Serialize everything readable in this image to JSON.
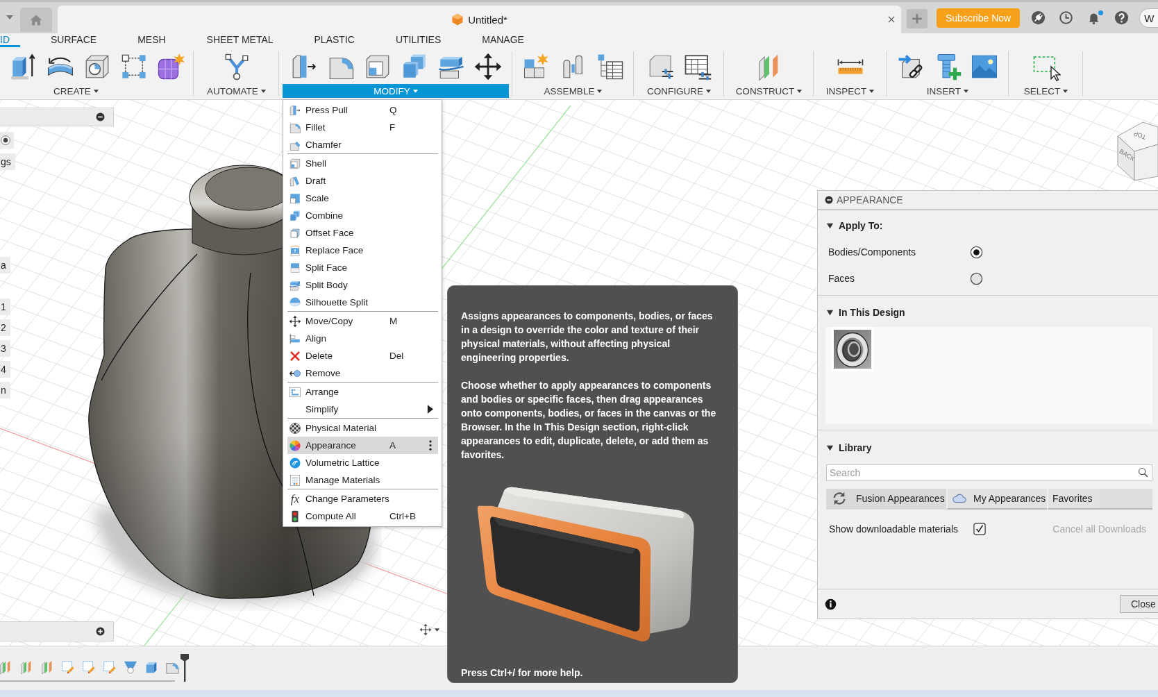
{
  "title_bar": {
    "document_tab": {
      "title": "Untitled*"
    },
    "subscribe_button": {
      "label": "Subscribe Now"
    },
    "notifications_unread": true,
    "user_avatar": {
      "initial": "W"
    }
  },
  "ribbon": {
    "tabs": [
      {
        "label": "ID",
        "selected": true
      },
      {
        "label": "SURFACE",
        "selected": false
      },
      {
        "label": "MESH",
        "selected": false
      },
      {
        "label": "SHEET METAL",
        "selected": false
      },
      {
        "label": "PLASTIC",
        "selected": false
      },
      {
        "label": "UTILITIES",
        "selected": false
      },
      {
        "label": "MANAGE",
        "selected": false
      }
    ],
    "groups": [
      {
        "label": "CREATE",
        "selected": false
      },
      {
        "label": "AUTOMATE",
        "selected": false
      },
      {
        "label": "MODIFY",
        "selected": true
      },
      {
        "label": "ASSEMBLE",
        "selected": false
      },
      {
        "label": "CONFIGURE",
        "selected": false
      },
      {
        "label": "CONSTRUCT",
        "selected": false
      },
      {
        "label": "INSPECT",
        "selected": false
      },
      {
        "label": "INSERT",
        "selected": false
      },
      {
        "label": "SELECT",
        "selected": false
      }
    ]
  },
  "browser": {
    "items": [
      "gs",
      "a",
      "1",
      "2",
      "3",
      "4",
      "n"
    ]
  },
  "view_cube": {
    "faces": [
      "TOP",
      "BACK"
    ]
  },
  "modify_menu": {
    "sections": [
      {
        "items": [
          {
            "label": "Press Pull",
            "shortcut": "Q",
            "selected": false,
            "submenu": false
          },
          {
            "label": "Fillet",
            "shortcut": "F",
            "selected": false,
            "submenu": false
          },
          {
            "label": "Chamfer",
            "selected": false,
            "submenu": false
          }
        ]
      },
      {
        "items": [
          {
            "label": "Shell",
            "selected": false,
            "submenu": false
          },
          {
            "label": "Draft",
            "selected": false,
            "submenu": false
          },
          {
            "label": "Scale",
            "selected": false,
            "submenu": false
          },
          {
            "label": "Combine",
            "selected": false,
            "submenu": false
          },
          {
            "label": "Offset Face",
            "selected": false,
            "submenu": false
          },
          {
            "label": "Replace Face",
            "selected": false,
            "submenu": false
          },
          {
            "label": "Split Face",
            "selected": false,
            "submenu": false
          },
          {
            "label": "Split Body",
            "selected": false,
            "submenu": false
          },
          {
            "label": "Silhouette Split",
            "selected": false,
            "submenu": false
          }
        ]
      },
      {
        "items": [
          {
            "label": "Move/Copy",
            "shortcut": "M",
            "selected": false,
            "submenu": false
          },
          {
            "label": "Align",
            "selected": false,
            "submenu": false
          },
          {
            "label": "Delete",
            "shortcut": "Del",
            "selected": false,
            "submenu": false
          },
          {
            "label": "Remove",
            "selected": false,
            "submenu": false
          }
        ]
      },
      {
        "items": [
          {
            "label": "Arrange",
            "selected": false,
            "submenu": false
          },
          {
            "label": "Simplify",
            "selected": false,
            "submenu": true
          }
        ]
      },
      {
        "items": [
          {
            "label": "Physical Material",
            "selected": false,
            "submenu": false
          },
          {
            "label": "Appearance",
            "shortcut": "A",
            "selected": true,
            "submenu": false
          },
          {
            "label": "Volumetric Lattice",
            "selected": false,
            "submenu": false
          },
          {
            "label": "Manage Materials",
            "selected": false,
            "submenu": false
          }
        ]
      },
      {
        "items": [
          {
            "label": "Change Parameters",
            "icon_glyph": "fx",
            "selected": false,
            "submenu": false
          },
          {
            "label": "Compute All",
            "shortcut": "Ctrl+B",
            "selected": false,
            "submenu": false
          }
        ]
      }
    ]
  },
  "tooltip": {
    "paragraphs": [
      "Assigns appearances to components, bodies, or faces in a design to override the color and texture of their physical materials, without affecting physical engineering properties.",
      "Choose whether to apply appearances to components and bodies or specific faces, then drag appearances onto components, bodies, or faces in the canvas or the Browser. In the In This Design section, right-click appearances to edit, duplicate, delete, or add them as favorites."
    ],
    "footer": "Press Ctrl+/ for more help."
  },
  "appearance_panel": {
    "title": "APPEARANCE",
    "apply_to": {
      "title": "Apply To:",
      "expanded": true,
      "options": [
        {
          "label": "Bodies/Components",
          "selected": true
        },
        {
          "label": "Faces",
          "selected": false
        }
      ]
    },
    "in_this_design": {
      "title": "In This Design",
      "expanded": true
    },
    "library": {
      "title": "Library",
      "expanded": true,
      "search": {
        "placeholder": "Search"
      },
      "tabs": [
        {
          "label": "Fusion Appearances",
          "selected": true
        },
        {
          "label": "My Appearances",
          "selected": false
        },
        {
          "label": "Favorites",
          "selected": false
        }
      ],
      "show_downloadable": {
        "label": "Show downloadable materials",
        "checked": true
      },
      "cancel_downloads": {
        "label": "Cancel all Downloads",
        "disabled": true
      }
    },
    "close_button": {
      "label": "Close"
    }
  }
}
